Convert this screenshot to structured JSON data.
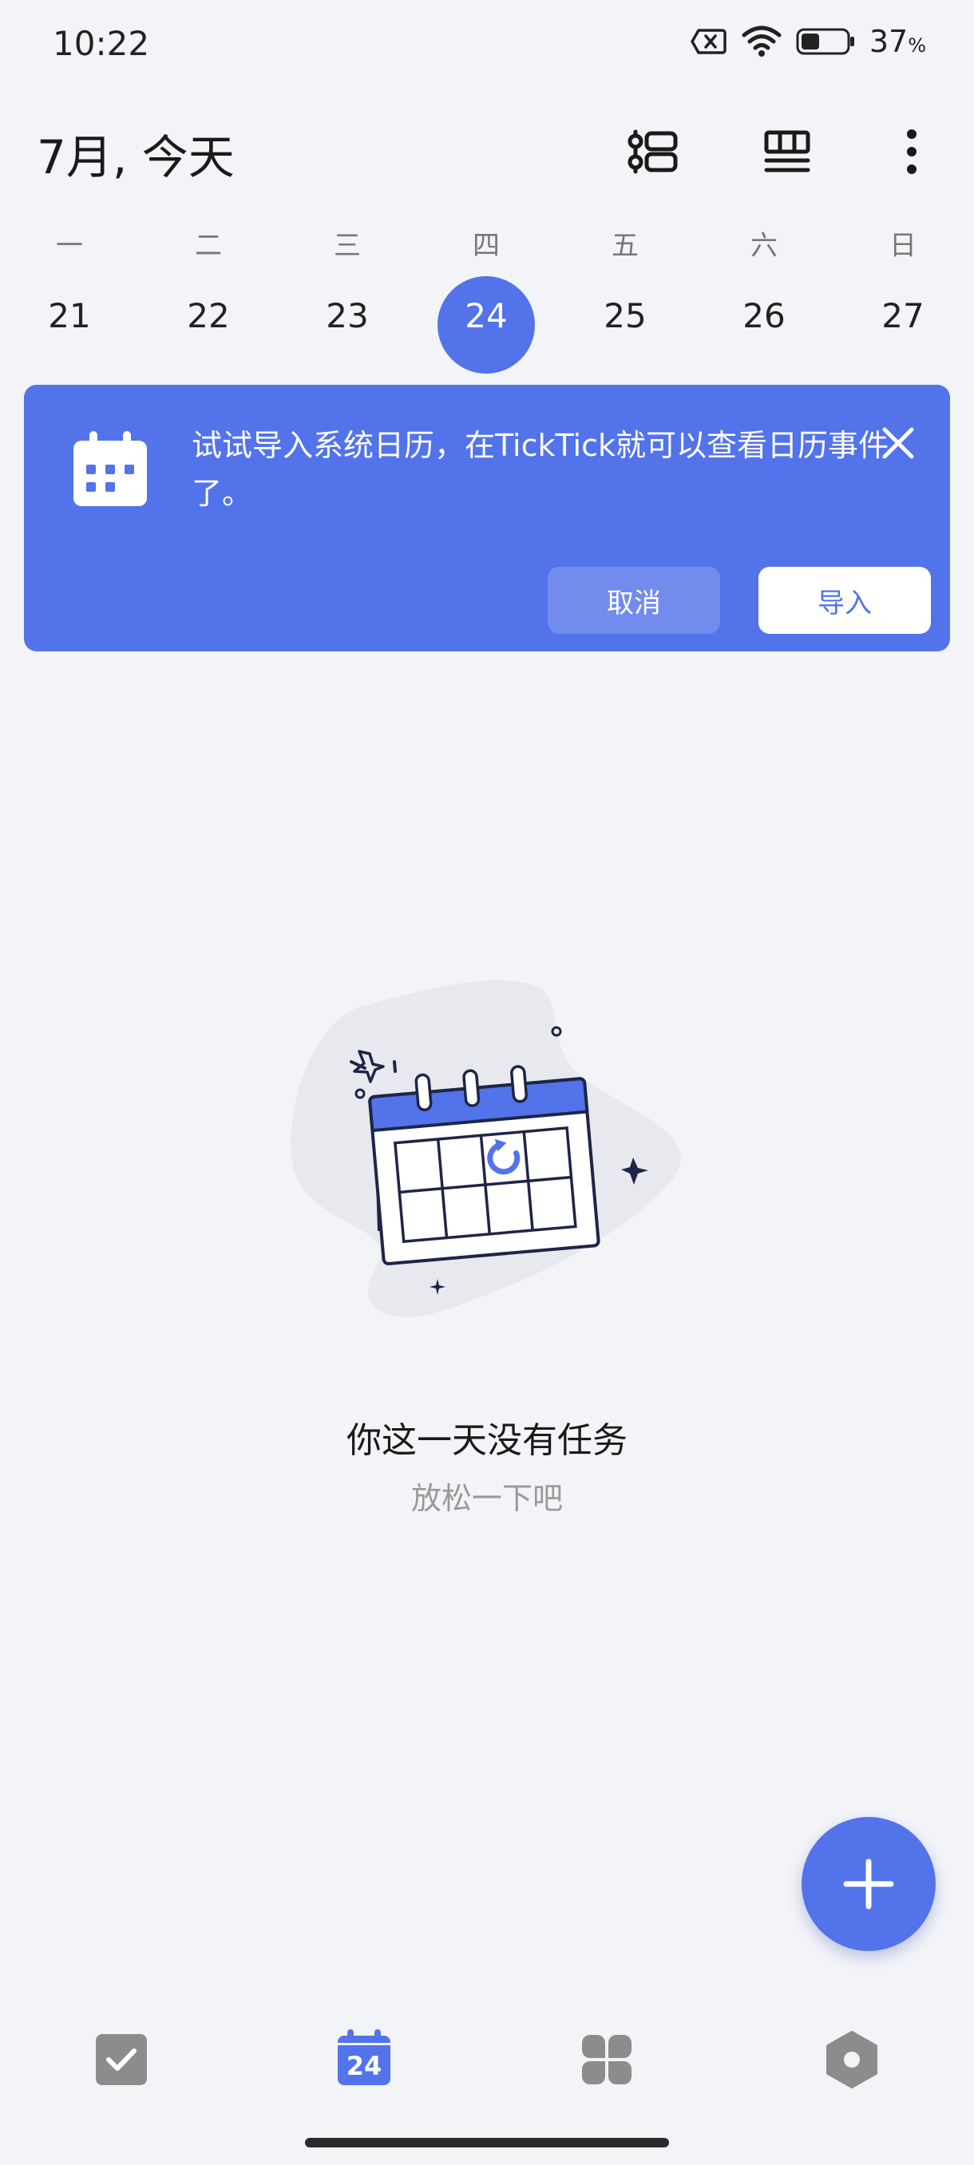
{
  "status_bar": {
    "time": "10:22",
    "battery_percent": "37",
    "battery_unit": "%",
    "icons": [
      "no-sim-icon",
      "wifi-icon",
      "battery-icon"
    ]
  },
  "header": {
    "title": "7月, 今天",
    "buttons": [
      "timeline-view-icon",
      "calendar-view-icon",
      "more-vertical-icon"
    ]
  },
  "week": {
    "weekdays": [
      "一",
      "二",
      "三",
      "四",
      "五",
      "六",
      "日"
    ],
    "dates": [
      "21",
      "22",
      "23",
      "24",
      "25",
      "26",
      "27"
    ],
    "selected_date": "24"
  },
  "banner": {
    "text": "试试导入系统日历，在TickTick就可以查看日历事件了。",
    "cancel_label": "取消",
    "import_label": "导入"
  },
  "empty_state": {
    "title": "你这一天没有任务",
    "subtitle": "放松一下吧"
  },
  "bottom_nav": {
    "calendar_badge": "24",
    "items": [
      "tasks-icon",
      "calendar-icon",
      "apps-grid-icon",
      "settings-hexagon-icon"
    ]
  },
  "colors": {
    "accent": "#5273ea",
    "background": "#f3f4f8",
    "nav_icon": "#8c8c8c"
  }
}
